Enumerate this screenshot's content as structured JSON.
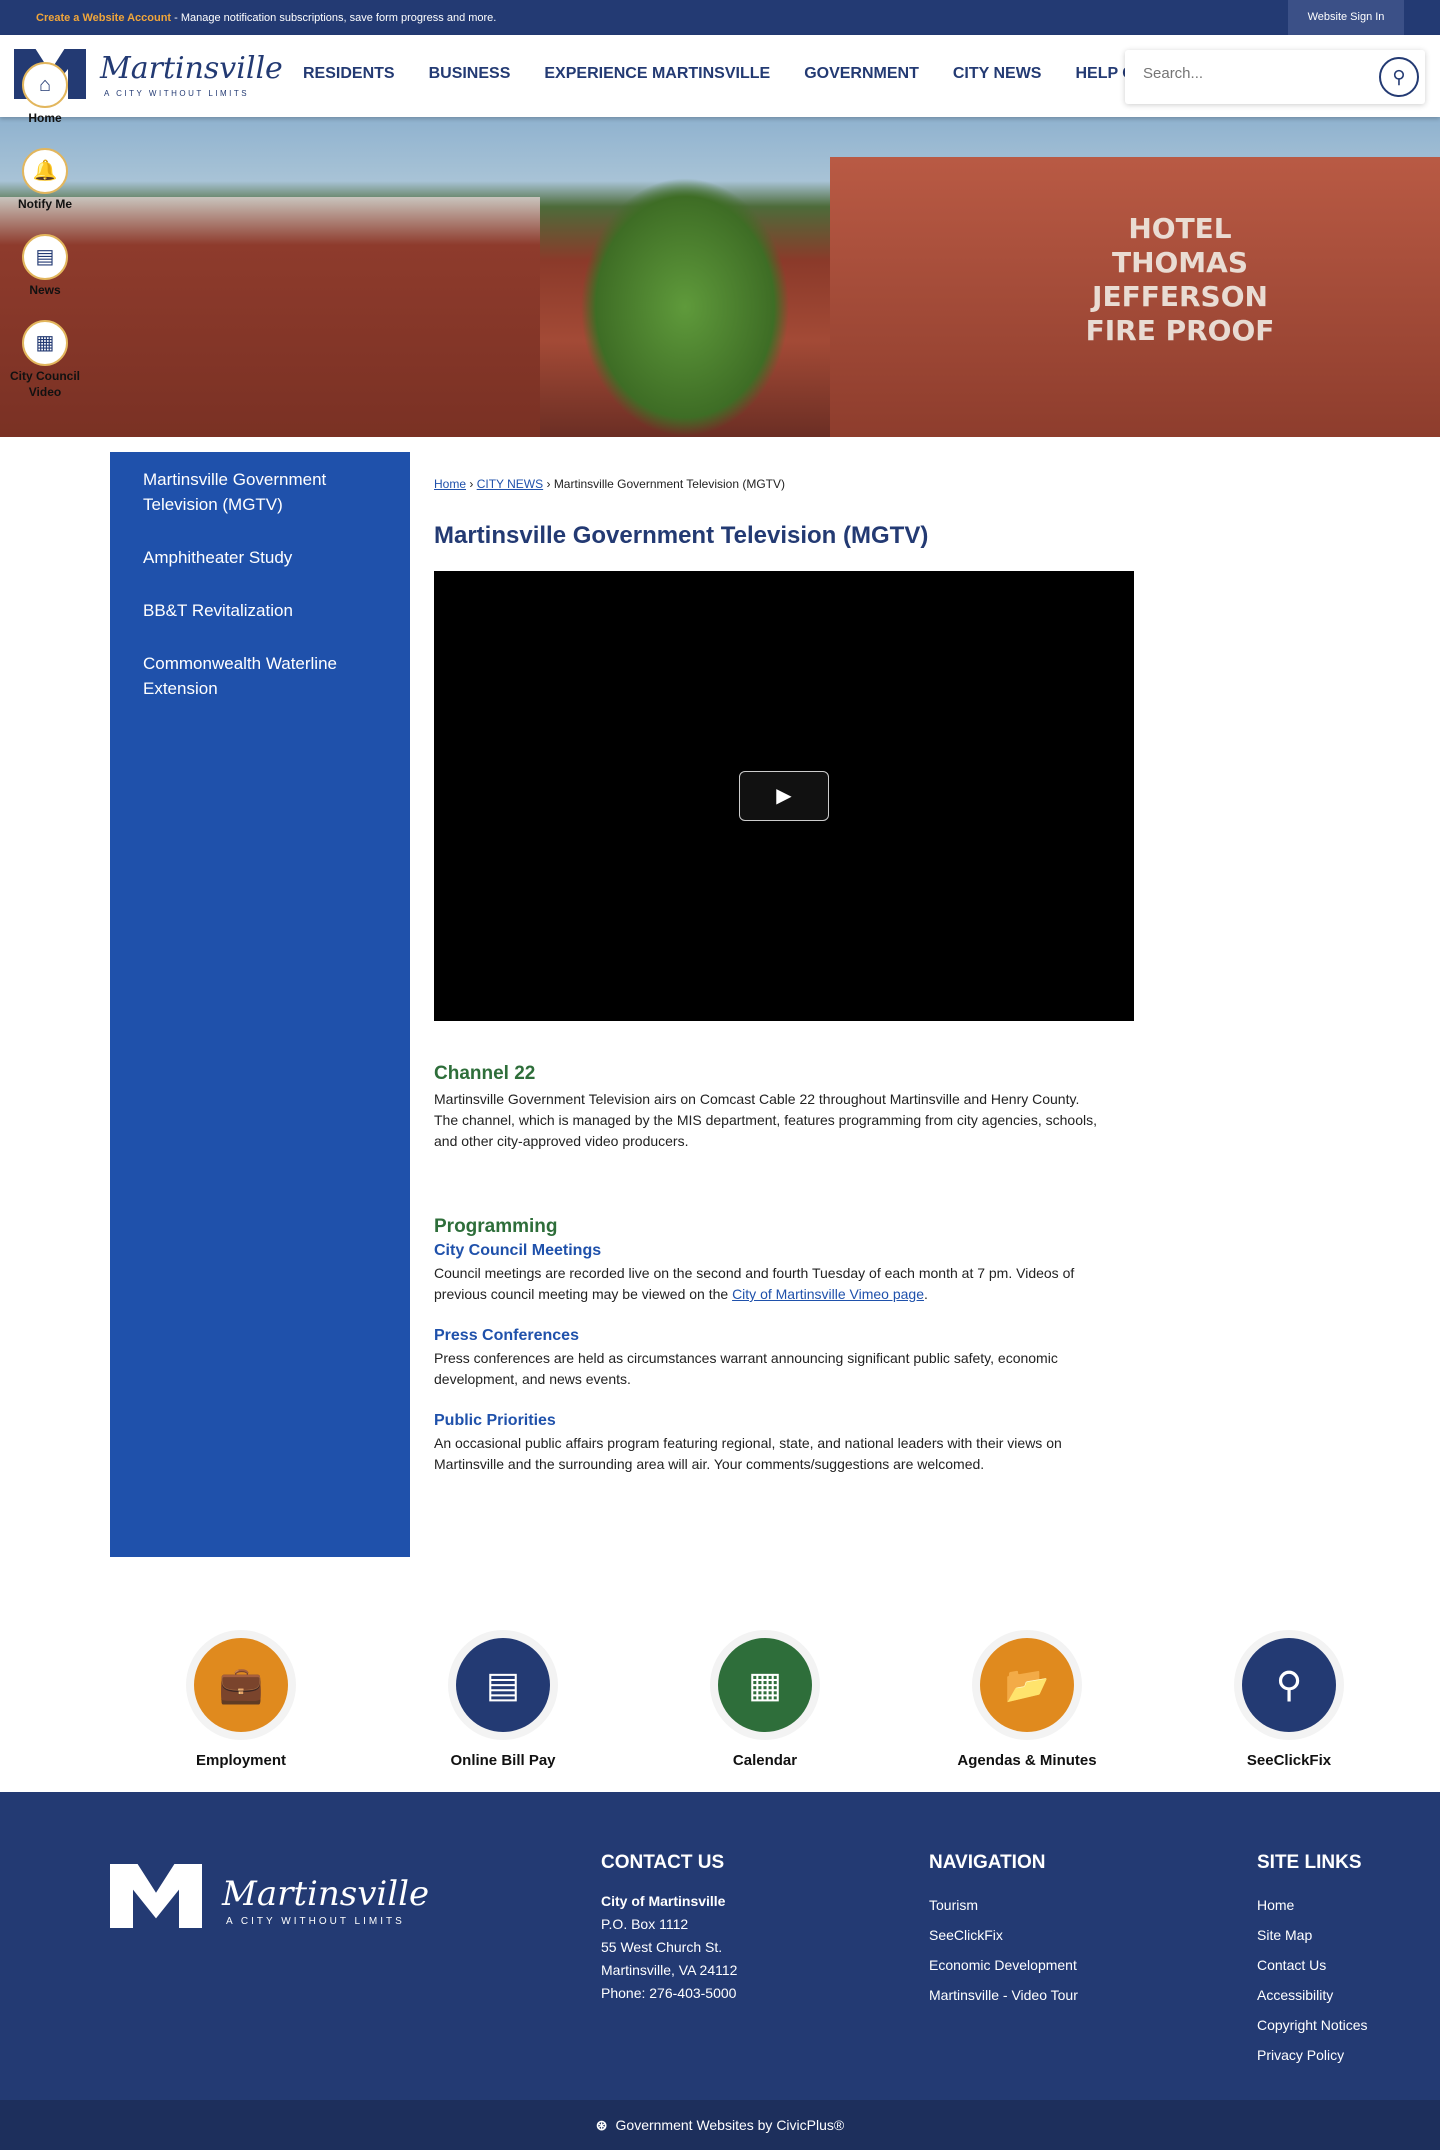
{
  "topbar": {
    "account_link": "Create a Website Account",
    "message": " - Manage notification subscriptions, save form progress and more.",
    "sign_in": "Website Sign In"
  },
  "header": {
    "logo_name": "Martinsville",
    "logo_tagline": "A CITY WITHOUT LIMITS",
    "nav": [
      "RESIDENTS",
      "BUSINESS",
      "EXPERIENCE MARTINSVILLE",
      "GOVERNMENT",
      "CITY NEWS",
      "HELP CENTER"
    ],
    "search_placeholder": "Search..."
  },
  "hero": {
    "sign_text": "HOTEL THOMAS JEFFERSON FIRE PROOF"
  },
  "quick_links": [
    {
      "label": "Home",
      "icon": "home-icon"
    },
    {
      "label": "Notify Me",
      "icon": "bell-icon"
    },
    {
      "label": "News",
      "icon": "newspaper-icon"
    },
    {
      "label": "City Council Video",
      "icon": "calendar-icon"
    }
  ],
  "sidebar": [
    "Martinsville Government Television (MGTV)",
    "Amphitheater Study",
    "BB&T Revitalization",
    "Commonwealth Waterline Extension"
  ],
  "breadcrumb": {
    "home": "Home",
    "sep": " › ",
    "section": "CITY NEWS",
    "current": "Martinsville Government Television (MGTV)"
  },
  "page_title": "Martinsville Government Television (MGTV)",
  "channel": {
    "heading": "Channel 22",
    "text": "Martinsville Government Television airs on Comcast Cable 22 throughout Martinsville and Henry County. The channel, which is managed by the MIS department, features programming from city agencies, schools, and other city-approved video producers."
  },
  "programming": {
    "heading": "Programming",
    "council": {
      "title": "City Council Meetings",
      "text": "Council meetings are recorded live on the second and fourth Tuesday of each month at 7 pm. Videos of previous council meeting may be viewed on the ",
      "link": "City of Martinsville Vimeo page",
      "end": "."
    },
    "press": {
      "title": "Press Conferences",
      "text": "Press conferences are held as circumstances warrant announcing significant public safety, economic development, and news events."
    },
    "priorities": {
      "title": "Public Priorities",
      "text": "An occasional public affairs program featuring regional, state, and national leaders with their views on Martinsville and the surrounding area will air. Your comments/suggestions are welcomed."
    }
  },
  "tiles": [
    {
      "label": "Employment",
      "color": "#e08a1e"
    },
    {
      "label": "Online Bill Pay",
      "color": "#233a73"
    },
    {
      "label": "Calendar",
      "color": "#2e6e3a"
    },
    {
      "label": "Agendas & Minutes",
      "color": "#e08a1e"
    },
    {
      "label": "SeeClickFix",
      "color": "#233a73"
    }
  ],
  "footer": {
    "logo_name": "Martinsville",
    "logo_tagline": "A CITY WITHOUT LIMITS",
    "contact": {
      "heading": "CONTACT US",
      "name": "City of Martinsville",
      "lines": [
        "P.O. Box 1112",
        "55 West Church St.",
        "Martinsville, VA 24112",
        "Phone: 276-403-5000"
      ]
    },
    "navigation": {
      "heading": "NAVIGATION",
      "links": [
        "Tourism",
        "SeeClickFix",
        "Economic Development",
        "Martinsville - Video Tour"
      ]
    },
    "site_links": {
      "heading": "SITE LINKS",
      "links": [
        "Home",
        "Site Map",
        "Contact Us",
        "Accessibility",
        "Copyright Notices",
        "Privacy Policy"
      ]
    },
    "credit": "Government Websites by CivicPlus®"
  }
}
